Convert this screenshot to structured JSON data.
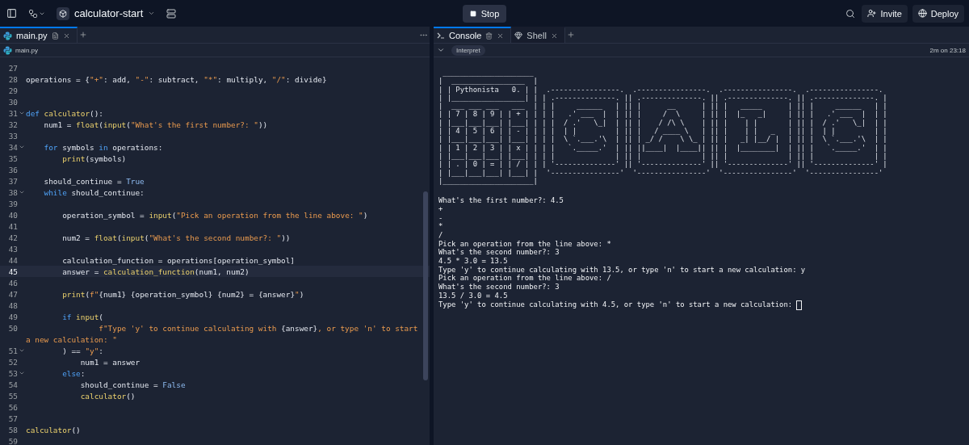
{
  "topbar": {
    "project": "calculator-start",
    "run_button": "Stop",
    "invite": "Invite",
    "deploy": "Deploy"
  },
  "editor": {
    "tabs": [
      {
        "label": "main.py",
        "selected": true
      }
    ],
    "breadcrumb": "main.py",
    "lines": [
      {
        "number": "27",
        "fold": false,
        "current": false
      },
      {
        "number": "28",
        "fold": false,
        "current": false,
        "tokens": [
          {
            "kind": "plain",
            "text": "operations = {"
          },
          {
            "kind": "str",
            "text": "\"+\""
          },
          {
            "kind": "plain",
            "text": ": add, "
          },
          {
            "kind": "str",
            "text": "\"-\""
          },
          {
            "kind": "plain",
            "text": ": subtract, "
          },
          {
            "kind": "str",
            "text": "\"*\""
          },
          {
            "kind": "plain",
            "text": ": multiply, "
          },
          {
            "kind": "str",
            "text": "\"/\""
          },
          {
            "kind": "plain",
            "text": ": divide}"
          }
        ]
      },
      {
        "number": "29",
        "fold": false,
        "current": false
      },
      {
        "number": "30",
        "fold": false,
        "current": false
      },
      {
        "number": "31",
        "fold": true,
        "current": false,
        "tokens": [
          {
            "kind": "kw",
            "text": "def "
          },
          {
            "kind": "fn",
            "text": "calculator"
          },
          {
            "kind": "plain",
            "text": "():"
          }
        ]
      },
      {
        "number": "32",
        "fold": false,
        "current": false,
        "tokens": [
          {
            "kind": "plain",
            "text": "    num1 = "
          },
          {
            "kind": "fn",
            "text": "float"
          },
          {
            "kind": "plain",
            "text": "("
          },
          {
            "kind": "fn",
            "text": "input"
          },
          {
            "kind": "plain",
            "text": "("
          },
          {
            "kind": "str",
            "text": "\"What's the first number?: \""
          },
          {
            "kind": "plain",
            "text": "))"
          }
        ]
      },
      {
        "number": "33",
        "fold": false,
        "current": false
      },
      {
        "number": "34",
        "fold": true,
        "current": false,
        "tokens": [
          {
            "kind": "kw",
            "text": "    for"
          },
          {
            "kind": "plain",
            "text": " symbols "
          },
          {
            "kind": "kw",
            "text": "in"
          },
          {
            "kind": "plain",
            "text": " operations:"
          }
        ]
      },
      {
        "number": "35",
        "fold": false,
        "current": false,
        "tokens": [
          {
            "kind": "fn",
            "text": "        print"
          },
          {
            "kind": "plain",
            "text": "(symbols)"
          }
        ]
      },
      {
        "number": "36",
        "fold": false,
        "current": false
      },
      {
        "number": "37",
        "fold": false,
        "current": false,
        "tokens": [
          {
            "kind": "plain",
            "text": "    should_continue = "
          },
          {
            "kind": "const",
            "text": "True"
          }
        ]
      },
      {
        "number": "38",
        "fold": true,
        "current": false,
        "tokens": [
          {
            "kind": "kw",
            "text": "    while"
          },
          {
            "kind": "plain",
            "text": " should_continue:"
          }
        ]
      },
      {
        "number": "39",
        "fold": false,
        "current": false
      },
      {
        "number": "40",
        "fold": false,
        "current": false,
        "tokens": [
          {
            "kind": "plain",
            "text": "        operation_symbol = "
          },
          {
            "kind": "fn",
            "text": "input"
          },
          {
            "kind": "plain",
            "text": "("
          },
          {
            "kind": "str",
            "text": "\"Pick an operation from the line above: \""
          },
          {
            "kind": "plain",
            "text": ")"
          }
        ]
      },
      {
        "number": "41",
        "fold": false,
        "current": false
      },
      {
        "number": "42",
        "fold": false,
        "current": false,
        "tokens": [
          {
            "kind": "plain",
            "text": "        num2 = "
          },
          {
            "kind": "fn",
            "text": "float"
          },
          {
            "kind": "plain",
            "text": "("
          },
          {
            "kind": "fn",
            "text": "input"
          },
          {
            "kind": "plain",
            "text": "("
          },
          {
            "kind": "str",
            "text": "\"What's the second number?: \""
          },
          {
            "kind": "plain",
            "text": "))"
          }
        ]
      },
      {
        "number": "43",
        "fold": false,
        "current": false
      },
      {
        "number": "44",
        "fold": false,
        "current": false,
        "tokens": [
          {
            "kind": "plain",
            "text": "        calculation_function = operations[operation_symbol]"
          }
        ]
      },
      {
        "number": "45",
        "fold": false,
        "current": true,
        "tokens": [
          {
            "kind": "plain",
            "text": "        answer = "
          },
          {
            "kind": "fn",
            "text": "calculation_function"
          },
          {
            "kind": "plain",
            "text": "(num1, num2)"
          }
        ]
      },
      {
        "number": "46",
        "fold": false,
        "current": false
      },
      {
        "number": "47",
        "fold": false,
        "current": false,
        "tokens": [
          {
            "kind": "fn",
            "text": "        print"
          },
          {
            "kind": "plain",
            "text": "("
          },
          {
            "kind": "str",
            "text": "f\""
          },
          {
            "kind": "plain",
            "text": "{num1} {operation_symbol} {num2} = {answer}"
          },
          {
            "kind": "str",
            "text": "\""
          },
          {
            "kind": "plain",
            "text": ")"
          }
        ]
      },
      {
        "number": "48",
        "fold": false,
        "current": false
      },
      {
        "number": "49",
        "fold": false,
        "current": false,
        "tokens": [
          {
            "kind": "kw",
            "text": "        if "
          },
          {
            "kind": "fn",
            "text": "input"
          },
          {
            "kind": "plain",
            "text": "("
          }
        ]
      },
      {
        "number": "50",
        "fold": false,
        "current": false,
        "tokens": [
          {
            "kind": "str",
            "text": "                f\"Type 'y' to continue calculating with "
          },
          {
            "kind": "plain",
            "text": "{answer}"
          },
          {
            "kind": "str",
            "text": ", or type 'n' to start"
          }
        ],
        "continuation": [
          {
            "kind": "str",
            "text": "a new calculation: \""
          }
        ]
      },
      {
        "number": "51",
        "fold": true,
        "current": false,
        "tokens": [
          {
            "kind": "plain",
            "text": "        ) == "
          },
          {
            "kind": "str",
            "text": "\"y\""
          },
          {
            "kind": "plain",
            "text": ":"
          }
        ]
      },
      {
        "number": "52",
        "fold": false,
        "current": false,
        "tokens": [
          {
            "kind": "plain",
            "text": "            num1 = answer"
          }
        ]
      },
      {
        "number": "53",
        "fold": true,
        "current": false,
        "tokens": [
          {
            "kind": "kw",
            "text": "        else"
          },
          {
            "kind": "plain",
            "text": ":"
          }
        ]
      },
      {
        "number": "54",
        "fold": false,
        "current": false,
        "tokens": [
          {
            "kind": "plain",
            "text": "            should_continue = "
          },
          {
            "kind": "const",
            "text": "False"
          }
        ]
      },
      {
        "number": "55",
        "fold": false,
        "current": false,
        "tokens": [
          {
            "kind": "fn",
            "text": "            calculator"
          },
          {
            "kind": "plain",
            "text": "()"
          }
        ]
      },
      {
        "number": "56",
        "fold": false,
        "current": false
      },
      {
        "number": "57",
        "fold": false,
        "current": false
      },
      {
        "number": "58",
        "fold": false,
        "current": false,
        "tokens": [
          {
            "kind": "fn",
            "text": "calculator"
          },
          {
            "kind": "plain",
            "text": "()"
          }
        ]
      },
      {
        "number": "59",
        "fold": false,
        "current": false
      }
    ]
  },
  "console": {
    "tabs": [
      {
        "label": "Console",
        "kind": "console",
        "selected": true
      },
      {
        "label": "Shell",
        "kind": "shell",
        "selected": false
      }
    ],
    "mode": "Interpret",
    "status": "2m on 23:18",
    "cursor": true,
    "art": [
      " _____________________",
      "|  _________________  |",
      "| | Pythonista   0. | |  .----------------.  .----------------.  .----------------.  .----------------.",
      "| |_________________| | | .--------------. || .--------------. || .--------------. || .--------------. |",
      "|  ___ ___ ___   ___  | | |     ______   | || |      __      | || |   _____      | || |     ______   | |",
      "| | 7 | 8 | 9 | | + | | | |   .' ___  |  | || |     /  \\     | || |  |_   _|     | || |   .' ___  |  | |",
      "| |___|___|___| |___| | | |  / .'   \\_|  | || |    / /\\ \\    | || |    | |       | || |  / .'   \\_|  | |",
      "| | 4 | 5 | 6 | | - | | | |  | |         | || |   / ____ \\   | || |    | |   _   | || |  | |         | |",
      "| |___|___|___| |___| | | |  \\ `.___.'\\  | || | _/ /    \\ \\_ | || |   _| |__/ |  | || |  \\ `.___.'\\  | |",
      "| | 1 | 2 | 3 | | x | | | |   `._____.'  | || ||____|  |____|| || |  |________|  | || |   `._____.'  | |",
      "| |___|___|___| |___| | | |              | || |              | || |              | || |              | |",
      "| | . | 0 | = | | / | | | '--------------' || '--------------' || '--------------' || '--------------' |",
      "| |___|___|___| |___| |  '----------------'  '----------------'  '----------------'  '----------------'",
      "|_____________________|"
    ],
    "output": [
      "What's the first number?: 4.5",
      "+",
      "-",
      "*",
      "/",
      "Pick an operation from the line above: *",
      "What's the second number?: 3",
      "4.5 * 3.0 = 13.5",
      "Type 'y' to continue calculating with 13.5, or type 'n' to start a new calculation: y",
      "Pick an operation from the line above: /",
      "What's the second number?: 3",
      "13.5 / 3.0 = 4.5",
      "Type 'y' to continue calculating with 4.5, or type 'n' to start a new calculation:"
    ]
  }
}
